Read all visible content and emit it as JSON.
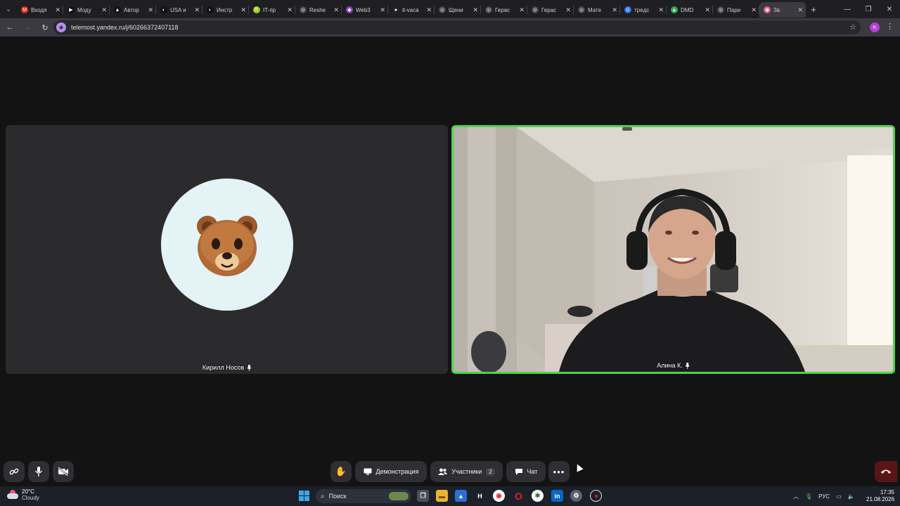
{
  "browser": {
    "tabs": [
      {
        "title": "Входя",
        "color": "#d93025",
        "glyph": "M"
      },
      {
        "title": "Моду",
        "color": "#111111",
        "glyph": "▶"
      },
      {
        "title": "Автор",
        "color": "#111111",
        "glyph": "▲"
      },
      {
        "title": "USA и",
        "color": "#111111",
        "glyph": "◐"
      },
      {
        "title": "Инстр",
        "color": "#111111",
        "glyph": "◐"
      },
      {
        "title": "IT-пр",
        "color": "#9ccc2e",
        "glyph": "F"
      },
      {
        "title": "Reshe",
        "color": "#444444",
        "glyph": "◎"
      },
      {
        "title": "Web3",
        "color": "#8b3fbf",
        "glyph": "◆"
      },
      {
        "title": "it-vaca",
        "color": "#222222",
        "glyph": "●"
      },
      {
        "title": "Щени",
        "color": "#444444",
        "glyph": "◎"
      },
      {
        "title": "Герас",
        "color": "#444444",
        "glyph": "◎"
      },
      {
        "title": "Герас",
        "color": "#444444",
        "glyph": "◎"
      },
      {
        "title": "Мате",
        "color": "#444444",
        "glyph": "◎"
      },
      {
        "title": "трeдс",
        "color": "#2f6fe0",
        "glyph": "G"
      },
      {
        "title": "DMD",
        "color": "#34a853",
        "glyph": "▲"
      },
      {
        "title": "Пари",
        "color": "#444444",
        "glyph": "◎"
      },
      {
        "title": "Зв",
        "color": "#e05b8e",
        "glyph": "◉",
        "active": true
      }
    ],
    "url": "telemost.yandex.ru/j/60266372407118",
    "profile_initial": "K"
  },
  "meeting": {
    "participants": [
      {
        "name": "Кирилл Носов",
        "avatar_emoji": "🐻"
      },
      {
        "name": "Алина К."
      }
    ],
    "controls": {
      "demo_label": "Демонстрация",
      "participants_label": "Участники",
      "participants_count": "2",
      "chat_label": "Чат"
    }
  },
  "taskbar": {
    "temperature": "20°C",
    "weather": "Cloudy",
    "search_placeholder": "Поиск",
    "lang": "РУС",
    "time": "17:35",
    "date": "21.08.2026"
  },
  "colors": {
    "active_speaker": "#4bd44b",
    "hangup": "#5a1616"
  }
}
